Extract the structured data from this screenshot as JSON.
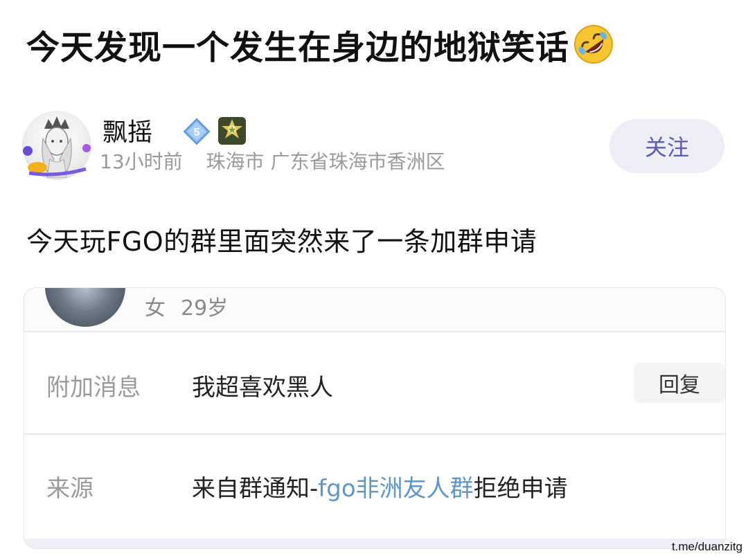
{
  "post": {
    "title": "今天发现一个发生在身边的地狱笑话",
    "title_emoji": "rolling-on-floor-laughing-emoji",
    "body": "今天玩FGO的群里面突然来了一条加群申请"
  },
  "author": {
    "name": "飘摇",
    "level": "5",
    "medal_icon": "medal-icon",
    "time": "13小时前",
    "city": "珠海市",
    "location": "广东省珠海市香洲区",
    "follow_label": "关注"
  },
  "screenshot": {
    "gender": "女",
    "age": "29岁",
    "message_label": "附加消息",
    "message_value": "我超喜欢黑人",
    "reply_label": "回复",
    "source_label": "来源",
    "source_prefix": "来自群通知-",
    "source_group": "fgo非洲友人群",
    "source_suffix": "拒绝申请"
  },
  "watermark": "t.me/duanzitg",
  "colors": {
    "follow_text": "#5b5bb0",
    "follow_bg": "#eeeef6",
    "link": "#5d97c8",
    "meta_text": "#9a9a9a"
  }
}
